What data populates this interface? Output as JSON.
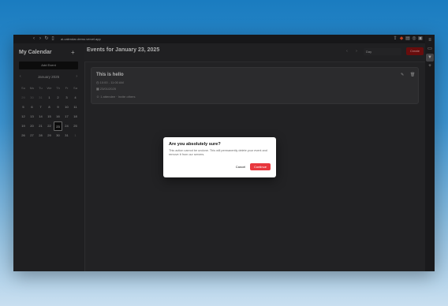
{
  "browser": {
    "url": "ai-calendar-demo.vercel.app",
    "nav": {
      "back": "‹",
      "forward": "›",
      "reload": "↻",
      "bookmark": "▯"
    }
  },
  "sidebar": {
    "title": "My Calendar",
    "add_label": "+",
    "today_button": "Add Event",
    "mini_month": "January 2025",
    "weekdays": [
      "Su",
      "Mo",
      "Tu",
      "We",
      "Th",
      "Fr",
      "Sa"
    ],
    "weeks": [
      [
        "29",
        "30",
        "31",
        "1",
        "2",
        "3",
        "4"
      ],
      [
        "5",
        "6",
        "7",
        "8",
        "9",
        "10",
        "11"
      ],
      [
        "12",
        "13",
        "14",
        "15",
        "16",
        "17",
        "18"
      ],
      [
        "19",
        "20",
        "21",
        "22",
        "23",
        "24",
        "25"
      ],
      [
        "26",
        "27",
        "28",
        "29",
        "30",
        "31",
        "1"
      ]
    ],
    "selected_day": "23"
  },
  "main": {
    "title": "Events for January 23, 2025",
    "view_select": "Day",
    "create_button": "Create"
  },
  "event": {
    "title": "This is hello",
    "time": "10:00 - 11:00 AM",
    "date": "23/01/2025",
    "participants": "1 attendee · Invite others"
  },
  "dialog": {
    "title": "Are you absolutely sure?",
    "description": "This action cannot be undone. This will permanently delete your event and remove it from our servers.",
    "cancel_label": "Cancel",
    "continue_label": "Continue"
  },
  "colors": {
    "accent_red": "#e8383e",
    "create_red": "#8a1212",
    "app_bg": "#2b2b2e"
  }
}
